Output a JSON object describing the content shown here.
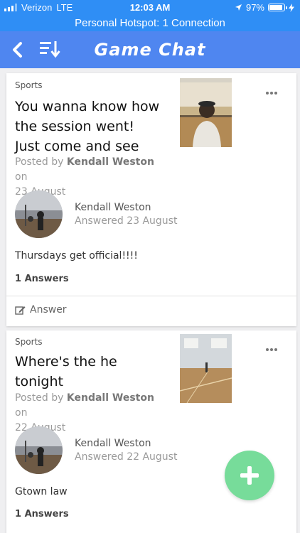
{
  "status_bar": {
    "carrier": "Verizon",
    "network": "LTE",
    "time": "12:03 AM",
    "battery": "97%",
    "battery_level": 0.97,
    "hotspot": "Personal Hotspot: 1 Connection"
  },
  "header": {
    "title": "Game Chat",
    "back_icon": "chevron-left-icon",
    "sort_icon": "sort-list-icon"
  },
  "posts": [
    {
      "category": "Sports",
      "title_lines": [
        "You wanna know how",
        "the session went!",
        "Just come and see"
      ],
      "posted_by_prefix": "Posted by",
      "author": "Kendall Weston",
      "on": "on",
      "date": "23 August",
      "answer": {
        "name": "Kendall Weston",
        "date": "Answered 23 August",
        "text": "Thursdays get official!!!!"
      },
      "answers_count": "1 Answers",
      "answer_button": "Answer"
    },
    {
      "category": "Sports",
      "title_lines": [
        "Where's the he",
        "tonight"
      ],
      "posted_by_prefix": "Posted by",
      "author": "Kendall Weston",
      "on": "on",
      "date": "22 August",
      "answer": {
        "name": "Kendall Weston",
        "date": "Answered 22 August",
        "text": "Gtown law"
      },
      "answers_count": "1 Answers"
    }
  ],
  "colors": {
    "status_bar": "#2f8ef5",
    "nav_bar": "#4f86f0",
    "fab": "#77dc9a"
  }
}
